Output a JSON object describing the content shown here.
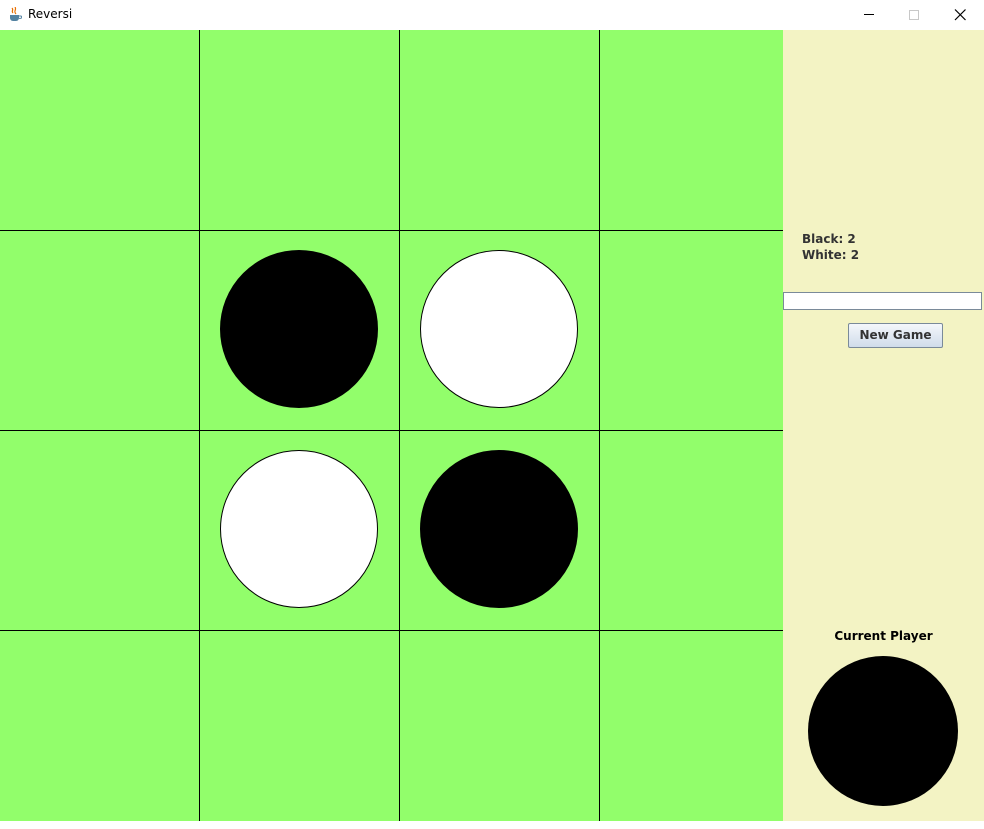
{
  "window": {
    "title": "Reversi",
    "controls": [
      "minimize",
      "maximize",
      "close"
    ]
  },
  "board": {
    "rows": 4,
    "cols": 4,
    "background": "#92fe6b",
    "line_color": "#000000",
    "cells": [
      [
        null,
        null,
        null,
        null
      ],
      [
        null,
        "black",
        "white",
        null
      ],
      [
        null,
        "white",
        "black",
        null
      ],
      [
        null,
        null,
        null,
        null
      ]
    ]
  },
  "side_panel": {
    "background": "#f3f3c4",
    "black_score": "Black: 2",
    "white_score": "White: 2",
    "status_text": "",
    "new_game_label": "New Game",
    "current_player_label": "Current Player",
    "current_player": "black"
  }
}
